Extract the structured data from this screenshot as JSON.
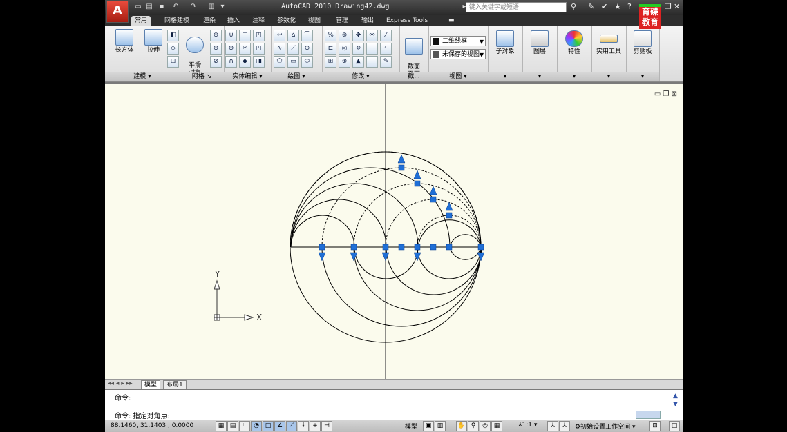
{
  "titlebar": {
    "app_title": "AutoCAD 2010  Drawing42.dwg",
    "search_placeholder": "键入关键字或短语",
    "logo_letter": "A",
    "badge_text": "育碟教育"
  },
  "menu_tabs": [
    "常用",
    "网格建模",
    "渲染",
    "插入",
    "注释",
    "参数化",
    "视图",
    "管理",
    "输出",
    "Express Tools"
  ],
  "active_tab": "常用",
  "ribbon": {
    "panels": {
      "modeling": "建模",
      "mesh": "网格",
      "solid_edit": "实体编辑",
      "draw": "绘图",
      "modify": "修改",
      "section": "截...",
      "view": "视图"
    },
    "buttons": {
      "box": "长方体",
      "extrude": "拉伸",
      "smooth_object": "平滑\n对象",
      "section_plane": "截面\n平面",
      "subobject": "子对象",
      "layers": "图层",
      "properties": "特性",
      "utilities": "实用工具",
      "clipboard": "剪贴板"
    },
    "combo_visual_style": "二维线框",
    "combo_view": "未保存的视图"
  },
  "viewport": {
    "ucs_x": "X",
    "ucs_y": "Y",
    "background_color": "#fbfbed",
    "grip_color": "#1f6fd6"
  },
  "layout_tabs": [
    "模型",
    "布局1"
  ],
  "command": {
    "line1": "命令:",
    "line2": "命令: 指定对角点:"
  },
  "statusbar": {
    "coordinates": "88.1460,  31.1403 , 0.0000",
    "model_label": "模型",
    "scale": "1:1",
    "workspace": "初始设置工作空间"
  }
}
